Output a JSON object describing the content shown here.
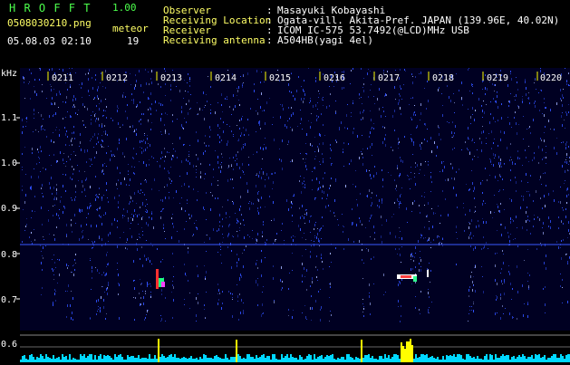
{
  "header": {
    "app_title": "H R O F F T",
    "version": "1.00",
    "filename": "0508030210.png",
    "meteor_label": "meteor",
    "datetime": "05.08.03 02:10",
    "meteor_count": "19",
    "fields": [
      {
        "label": "Observer",
        "sep": ":",
        "value": "Masayuki Kobayashi"
      },
      {
        "label": "Receiving Location",
        "sep": ":",
        "value": "Ogata-vill. Akita-Pref. JAPAN (139.96E, 40.02N)"
      },
      {
        "label": "Receiver",
        "sep": ":",
        "value": "ICOM IC-575 53.7492(@LCD)MHz USB"
      },
      {
        "label": "Receiving antenna",
        "sep": ":",
        "value": "A504HB(yagi 4el)"
      }
    ]
  },
  "spectrogram": {
    "unit_label": "kHz",
    "y_ticks": [
      "1.1",
      "1.0",
      "0.9",
      "0.8",
      "0.7"
    ],
    "time_ticks": [
      "0211",
      "0212",
      "0213",
      "0214",
      "0215",
      "0216",
      "0217",
      "0218",
      "0219",
      "0220"
    ],
    "colors": {
      "background": "#000022",
      "signal": "#3050ff",
      "bright": "#a0b0ff",
      "tick": "#ffff00",
      "line": "#3a5aff"
    }
  },
  "power_panel": {
    "y_ticks": [
      "0.6"
    ],
    "colors": {
      "fill": "#00d8ff",
      "peak": "#ffff00"
    }
  }
}
